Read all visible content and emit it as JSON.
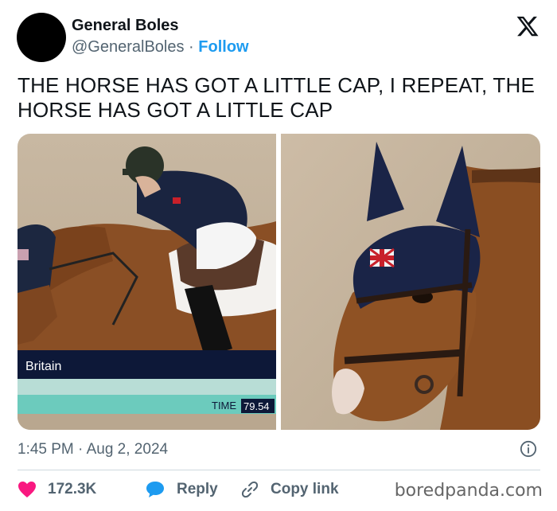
{
  "author": {
    "name": "General Boles",
    "handle": "@GeneralBoles",
    "separator": "·",
    "follow_label": "Follow"
  },
  "tweet": {
    "text": "THE HORSE HAS GOT A LITTLE CAP, I REPEAT, THE HORSE HAS GOT A LITTLE CAP",
    "timestamp": "1:45 PM · Aug 2, 2024"
  },
  "media": {
    "left_photo": {
      "overlay_country": "Britain",
      "overlay_time_label": "TIME",
      "overlay_time_value": "79.54"
    }
  },
  "actions": {
    "likes": "172.3K",
    "reply_label": "Reply",
    "copy_link_label": "Copy link"
  },
  "watermark": "boredpanda.com",
  "icons": {
    "platform": "x-logo-icon",
    "info": "info-icon",
    "like": "heart-icon",
    "reply": "speech-bubble-icon",
    "copy": "link-icon"
  },
  "colors": {
    "follow": "#1d9bf0",
    "like": "#f91880",
    "reply": "#1d9bf0",
    "secondary_text": "#536471"
  }
}
